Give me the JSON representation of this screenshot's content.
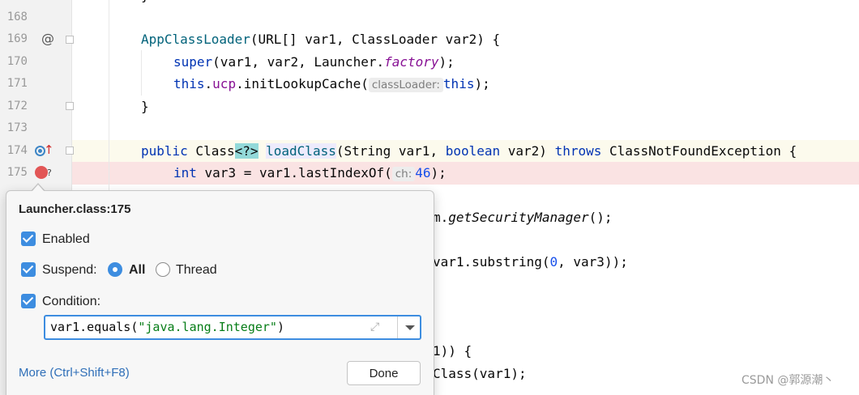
{
  "editor": {
    "line_numbers": [
      "168",
      "169",
      "170",
      "171",
      "172",
      "173",
      "174",
      "175"
    ],
    "gutter_icons": {
      "annotation": "@",
      "breakpoint_hint": "?"
    },
    "lines": {
      "l169": {
        "a": "AppClassLoader",
        "b": "(URL[] var1, ClassLoader var2) {"
      },
      "l170": {
        "a": "super",
        "b": "(var1, var2, Launcher.",
        "c": "factory",
        "d": ");"
      },
      "l171": {
        "a": "this",
        "b": ".",
        "c": "ucp",
        "d": ".initLookupCache(",
        "hint": "classLoader:",
        "e": "this",
        "f": ");"
      },
      "l172": {
        "a": "}"
      },
      "l174": {
        "a": "public",
        "b": " Class",
        "c": "<?>",
        "d": " ",
        "e": "loadClass",
        "f": "(String var1, ",
        "g": "boolean",
        "h": " var2) ",
        "i": "throws",
        "j": " ClassNotFoundException {"
      },
      "l175": {
        "a": "int",
        "b": " var3 = var1.lastIndexOf(",
        "hint": "ch:",
        "c": "46",
        "d": ");"
      }
    },
    "partial_lines": {
      "p1": {
        "a": "m.",
        "b": "getSecurityManager",
        "c": "();"
      },
      "p2": {
        "a": "var1.substring(",
        "b": "0",
        "c": ", var3));"
      },
      "p3": {
        "a": "1)) {"
      },
      "p4": {
        "a": "Class(var1);"
      }
    }
  },
  "popup": {
    "title": "Launcher.class:175",
    "enabled_label": "Enabled",
    "suspend_label": "Suspend:",
    "all_label": "All",
    "thread_label": "Thread",
    "condition_label": "Condition:",
    "condition": {
      "a": "var1.equals(",
      "b": "\"java.lang.Integer\"",
      "c": ")"
    },
    "more_link": "More (Ctrl+Shift+F8)",
    "done_label": "Done"
  },
  "watermark": "CSDN @郭源潮丶"
}
